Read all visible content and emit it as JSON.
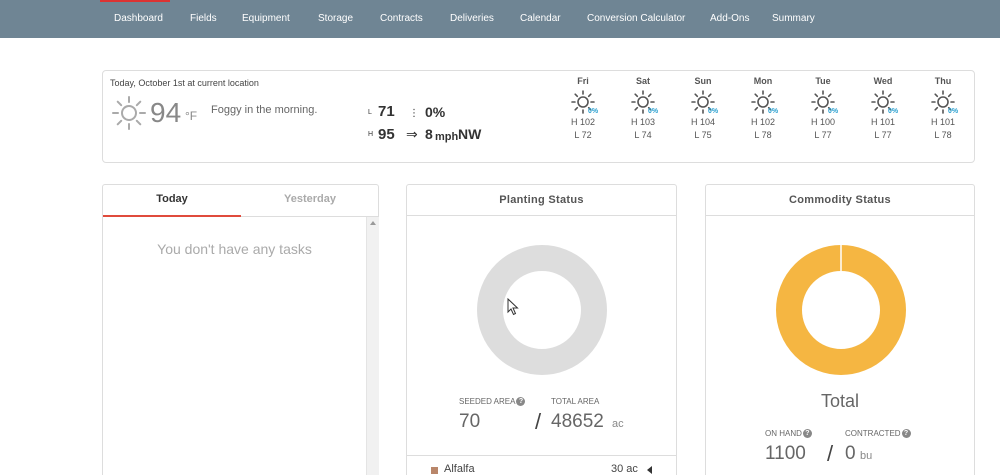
{
  "nav": {
    "items": [
      "Dashboard",
      "Fields",
      "Equipment",
      "Storage",
      "Contracts",
      "Deliveries",
      "Calendar",
      "Conversion Calculator",
      "Add-Ons",
      "Summary"
    ]
  },
  "weather": {
    "header": "Today, October 1st at current location",
    "current_temp": "94",
    "unit": "°F",
    "description": "Foggy in the morning.",
    "low_label": "L",
    "low": "71",
    "high_label": "H",
    "high": "95",
    "precip": "0%",
    "wind_speed": "8",
    "wind_unit": "mph",
    "wind_dir": "NW",
    "forecast": [
      {
        "day": "Fri",
        "pct": "0%",
        "hi": "H 102",
        "lo": "L 72"
      },
      {
        "day": "Sat",
        "pct": "0%",
        "hi": "H 103",
        "lo": "L 74"
      },
      {
        "day": "Sun",
        "pct": "0%",
        "hi": "H 104",
        "lo": "L 75"
      },
      {
        "day": "Mon",
        "pct": "0%",
        "hi": "H 102",
        "lo": "L 78"
      },
      {
        "day": "Tue",
        "pct": "0%",
        "hi": "H 100",
        "lo": "L 77"
      },
      {
        "day": "Wed",
        "pct": "0%",
        "hi": "H 101",
        "lo": "L 77"
      },
      {
        "day": "Thu",
        "pct": "0%",
        "hi": "H 101",
        "lo": "L 78"
      }
    ]
  },
  "tasks": {
    "tab_today": "Today",
    "tab_yesterday": "Yesterday",
    "empty": "You don't have any tasks"
  },
  "planting": {
    "title": "Planting Status",
    "seeded_label": "SEEDED AREA",
    "seeded_value": "70",
    "total_label": "TOTAL AREA",
    "total_value": "48652",
    "unit": "ac",
    "separator": "/",
    "help": "?",
    "crop": {
      "name": "Alfalfa",
      "area": "30 ac"
    }
  },
  "commodity": {
    "title": "Commodity Status",
    "center_label": "Total",
    "on_hand_label": "ON HAND",
    "on_hand_value": "1100",
    "contracted_label": "CONTRACTED",
    "contracted_value": "0",
    "unit": "bu",
    "separator": "/",
    "help": "?"
  },
  "colors": {
    "nav_bg": "#6f8594",
    "accent": "#e04b3c",
    "donut_empty": "#dddddd",
    "donut_commodity": "#f5b642",
    "precip": "#2aa0d0"
  }
}
